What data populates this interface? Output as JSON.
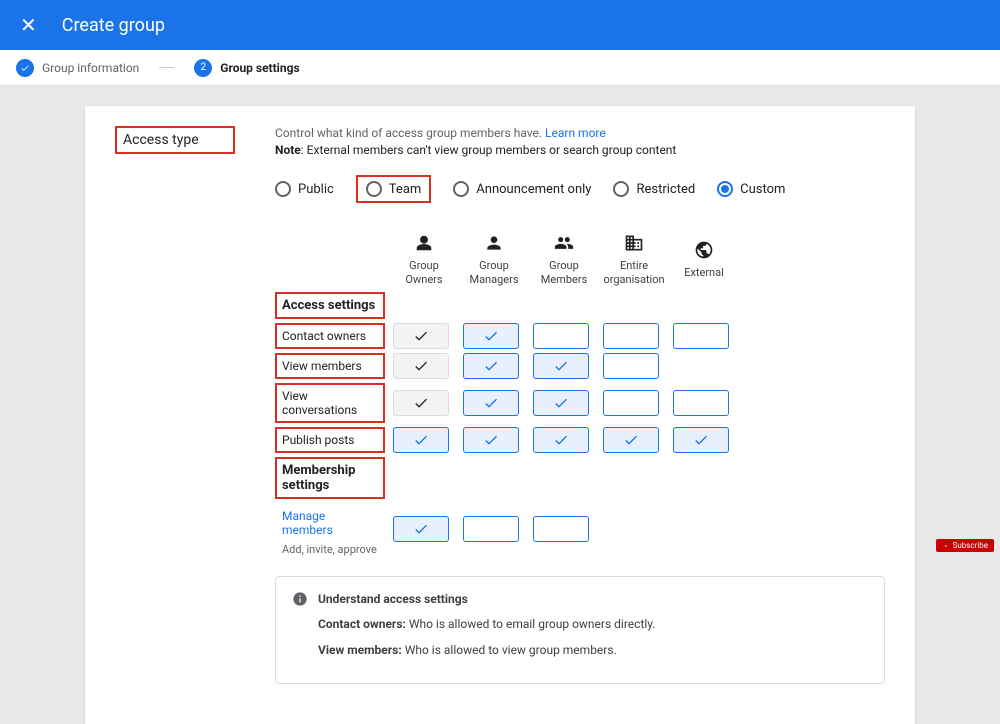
{
  "header": {
    "title": "Create group"
  },
  "stepper": {
    "step1": {
      "label": "Group information",
      "icon": "check"
    },
    "step2": {
      "label": "Group settings",
      "num": "2"
    }
  },
  "access": {
    "section_title": "Access type",
    "desc_prefix": "Control what kind of access group members have. ",
    "desc_link": "Learn more",
    "note_label": "Note",
    "note_text": ": External members can't view group members or search group content",
    "radios": {
      "public": "Public",
      "team": "Team",
      "announcement": "Announcement only",
      "restricted": "Restricted",
      "custom": "Custom"
    },
    "columns": {
      "c1": "Group Owners",
      "c2": "Group Managers",
      "c3": "Group Members",
      "c4": "Entire organisation",
      "c5": "External"
    },
    "rows": {
      "access_settings": "Access settings",
      "contact_owners": "Contact owners",
      "view_members": "View members",
      "view_conversations": "View conversations",
      "publish_posts": "Publish posts",
      "membership_settings": "Membership settings",
      "manage_members": "Manage members",
      "manage_members_sub": "Add, invite, approve"
    }
  },
  "info": {
    "title": "Understand access settings",
    "line1_label": "Contact owners:",
    "line1_text": " Who is allowed to email group owners directly.",
    "line2_label": "View members:",
    "line2_text": " Who is allowed to view group members."
  },
  "subscribe": "Subscribe"
}
